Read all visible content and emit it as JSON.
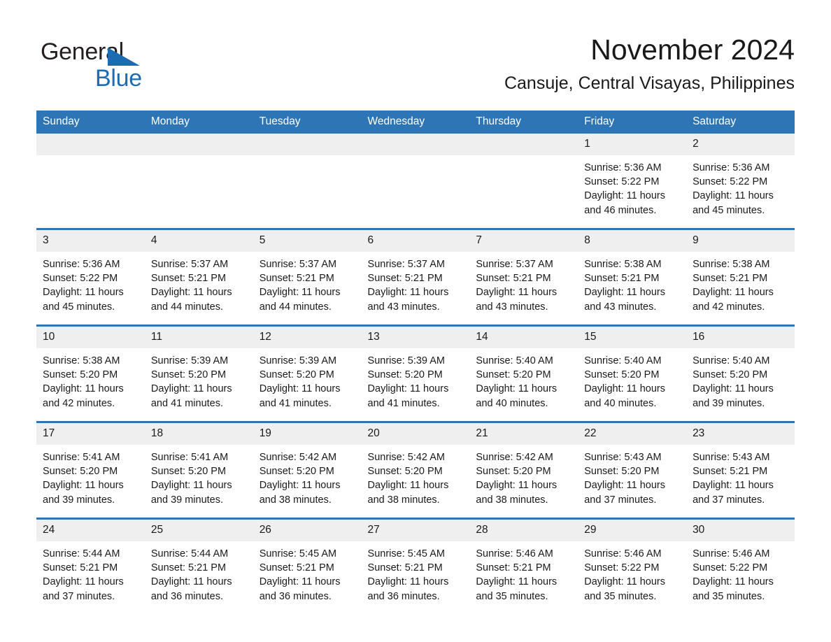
{
  "logo": {
    "word1": "General",
    "word2": "Blue",
    "triangle_color": "#1b6cb0"
  },
  "header": {
    "month_title": "November 2024",
    "location": "Cansuje, Central Visayas, Philippines"
  },
  "theme": {
    "header_blue": "#2e75b6",
    "daynum_gray": "#efefef",
    "text": "#1a1a1a"
  },
  "weekday_headers": [
    "Sunday",
    "Monday",
    "Tuesday",
    "Wednesday",
    "Thursday",
    "Friday",
    "Saturday"
  ],
  "weeks": [
    [
      {
        "day": "",
        "sunrise": "",
        "sunset": "",
        "daylight_1": "",
        "daylight_2": "",
        "empty": true
      },
      {
        "day": "",
        "sunrise": "",
        "sunset": "",
        "daylight_1": "",
        "daylight_2": "",
        "empty": true
      },
      {
        "day": "",
        "sunrise": "",
        "sunset": "",
        "daylight_1": "",
        "daylight_2": "",
        "empty": true
      },
      {
        "day": "",
        "sunrise": "",
        "sunset": "",
        "daylight_1": "",
        "daylight_2": "",
        "empty": true
      },
      {
        "day": "",
        "sunrise": "",
        "sunset": "",
        "daylight_1": "",
        "daylight_2": "",
        "empty": true
      },
      {
        "day": "1",
        "sunrise": "Sunrise: 5:36 AM",
        "sunset": "Sunset: 5:22 PM",
        "daylight_1": "Daylight: 11 hours",
        "daylight_2": "and 46 minutes."
      },
      {
        "day": "2",
        "sunrise": "Sunrise: 5:36 AM",
        "sunset": "Sunset: 5:22 PM",
        "daylight_1": "Daylight: 11 hours",
        "daylight_2": "and 45 minutes."
      }
    ],
    [
      {
        "day": "3",
        "sunrise": "Sunrise: 5:36 AM",
        "sunset": "Sunset: 5:22 PM",
        "daylight_1": "Daylight: 11 hours",
        "daylight_2": "and 45 minutes."
      },
      {
        "day": "4",
        "sunrise": "Sunrise: 5:37 AM",
        "sunset": "Sunset: 5:21 PM",
        "daylight_1": "Daylight: 11 hours",
        "daylight_2": "and 44 minutes."
      },
      {
        "day": "5",
        "sunrise": "Sunrise: 5:37 AM",
        "sunset": "Sunset: 5:21 PM",
        "daylight_1": "Daylight: 11 hours",
        "daylight_2": "and 44 minutes."
      },
      {
        "day": "6",
        "sunrise": "Sunrise: 5:37 AM",
        "sunset": "Sunset: 5:21 PM",
        "daylight_1": "Daylight: 11 hours",
        "daylight_2": "and 43 minutes."
      },
      {
        "day": "7",
        "sunrise": "Sunrise: 5:37 AM",
        "sunset": "Sunset: 5:21 PM",
        "daylight_1": "Daylight: 11 hours",
        "daylight_2": "and 43 minutes."
      },
      {
        "day": "8",
        "sunrise": "Sunrise: 5:38 AM",
        "sunset": "Sunset: 5:21 PM",
        "daylight_1": "Daylight: 11 hours",
        "daylight_2": "and 43 minutes."
      },
      {
        "day": "9",
        "sunrise": "Sunrise: 5:38 AM",
        "sunset": "Sunset: 5:21 PM",
        "daylight_1": "Daylight: 11 hours",
        "daylight_2": "and 42 minutes."
      }
    ],
    [
      {
        "day": "10",
        "sunrise": "Sunrise: 5:38 AM",
        "sunset": "Sunset: 5:20 PM",
        "daylight_1": "Daylight: 11 hours",
        "daylight_2": "and 42 minutes."
      },
      {
        "day": "11",
        "sunrise": "Sunrise: 5:39 AM",
        "sunset": "Sunset: 5:20 PM",
        "daylight_1": "Daylight: 11 hours",
        "daylight_2": "and 41 minutes."
      },
      {
        "day": "12",
        "sunrise": "Sunrise: 5:39 AM",
        "sunset": "Sunset: 5:20 PM",
        "daylight_1": "Daylight: 11 hours",
        "daylight_2": "and 41 minutes."
      },
      {
        "day": "13",
        "sunrise": "Sunrise: 5:39 AM",
        "sunset": "Sunset: 5:20 PM",
        "daylight_1": "Daylight: 11 hours",
        "daylight_2": "and 41 minutes."
      },
      {
        "day": "14",
        "sunrise": "Sunrise: 5:40 AM",
        "sunset": "Sunset: 5:20 PM",
        "daylight_1": "Daylight: 11 hours",
        "daylight_2": "and 40 minutes."
      },
      {
        "day": "15",
        "sunrise": "Sunrise: 5:40 AM",
        "sunset": "Sunset: 5:20 PM",
        "daylight_1": "Daylight: 11 hours",
        "daylight_2": "and 40 minutes."
      },
      {
        "day": "16",
        "sunrise": "Sunrise: 5:40 AM",
        "sunset": "Sunset: 5:20 PM",
        "daylight_1": "Daylight: 11 hours",
        "daylight_2": "and 39 minutes."
      }
    ],
    [
      {
        "day": "17",
        "sunrise": "Sunrise: 5:41 AM",
        "sunset": "Sunset: 5:20 PM",
        "daylight_1": "Daylight: 11 hours",
        "daylight_2": "and 39 minutes."
      },
      {
        "day": "18",
        "sunrise": "Sunrise: 5:41 AM",
        "sunset": "Sunset: 5:20 PM",
        "daylight_1": "Daylight: 11 hours",
        "daylight_2": "and 39 minutes."
      },
      {
        "day": "19",
        "sunrise": "Sunrise: 5:42 AM",
        "sunset": "Sunset: 5:20 PM",
        "daylight_1": "Daylight: 11 hours",
        "daylight_2": "and 38 minutes."
      },
      {
        "day": "20",
        "sunrise": "Sunrise: 5:42 AM",
        "sunset": "Sunset: 5:20 PM",
        "daylight_1": "Daylight: 11 hours",
        "daylight_2": "and 38 minutes."
      },
      {
        "day": "21",
        "sunrise": "Sunrise: 5:42 AM",
        "sunset": "Sunset: 5:20 PM",
        "daylight_1": "Daylight: 11 hours",
        "daylight_2": "and 38 minutes."
      },
      {
        "day": "22",
        "sunrise": "Sunrise: 5:43 AM",
        "sunset": "Sunset: 5:20 PM",
        "daylight_1": "Daylight: 11 hours",
        "daylight_2": "and 37 minutes."
      },
      {
        "day": "23",
        "sunrise": "Sunrise: 5:43 AM",
        "sunset": "Sunset: 5:21 PM",
        "daylight_1": "Daylight: 11 hours",
        "daylight_2": "and 37 minutes."
      }
    ],
    [
      {
        "day": "24",
        "sunrise": "Sunrise: 5:44 AM",
        "sunset": "Sunset: 5:21 PM",
        "daylight_1": "Daylight: 11 hours",
        "daylight_2": "and 37 minutes."
      },
      {
        "day": "25",
        "sunrise": "Sunrise: 5:44 AM",
        "sunset": "Sunset: 5:21 PM",
        "daylight_1": "Daylight: 11 hours",
        "daylight_2": "and 36 minutes."
      },
      {
        "day": "26",
        "sunrise": "Sunrise: 5:45 AM",
        "sunset": "Sunset: 5:21 PM",
        "daylight_1": "Daylight: 11 hours",
        "daylight_2": "and 36 minutes."
      },
      {
        "day": "27",
        "sunrise": "Sunrise: 5:45 AM",
        "sunset": "Sunset: 5:21 PM",
        "daylight_1": "Daylight: 11 hours",
        "daylight_2": "and 36 minutes."
      },
      {
        "day": "28",
        "sunrise": "Sunrise: 5:46 AM",
        "sunset": "Sunset: 5:21 PM",
        "daylight_1": "Daylight: 11 hours",
        "daylight_2": "and 35 minutes."
      },
      {
        "day": "29",
        "sunrise": "Sunrise: 5:46 AM",
        "sunset": "Sunset: 5:22 PM",
        "daylight_1": "Daylight: 11 hours",
        "daylight_2": "and 35 minutes."
      },
      {
        "day": "30",
        "sunrise": "Sunrise: 5:46 AM",
        "sunset": "Sunset: 5:22 PM",
        "daylight_1": "Daylight: 11 hours",
        "daylight_2": "and 35 minutes."
      }
    ]
  ]
}
